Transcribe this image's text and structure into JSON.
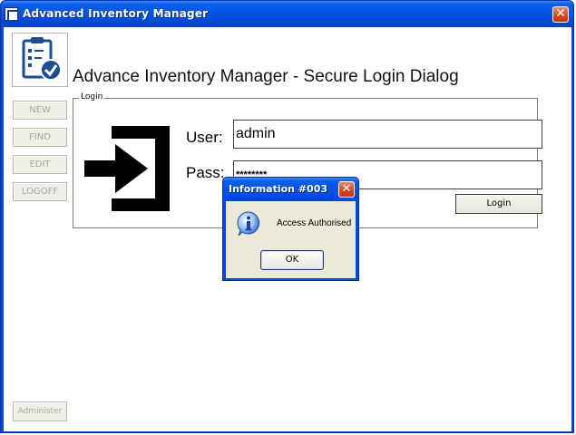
{
  "window": {
    "title": "Advanced Inventory Manager",
    "close_label": "✕"
  },
  "page": {
    "title": "Advance Inventory Manager - Secure Login Dialog"
  },
  "sidebar": {
    "buttons": [
      {
        "label": "NEW"
      },
      {
        "label": "FIND"
      },
      {
        "label": "EDIT"
      },
      {
        "label": "LOGOFF"
      }
    ],
    "administer_label": "Administer"
  },
  "login": {
    "group_label": "Login",
    "user_label": "User:",
    "user_value": "admin",
    "pass_label": "Pass:",
    "pass_value": "********",
    "login_button": "Login"
  },
  "dialog": {
    "title": "Information #003",
    "message": "Access Authorised",
    "ok_label": "OK",
    "close_label": "✕"
  },
  "colors": {
    "titlebar": "#0354e2",
    "close": "#d5451f",
    "dialog_body": "#ece9d8"
  }
}
